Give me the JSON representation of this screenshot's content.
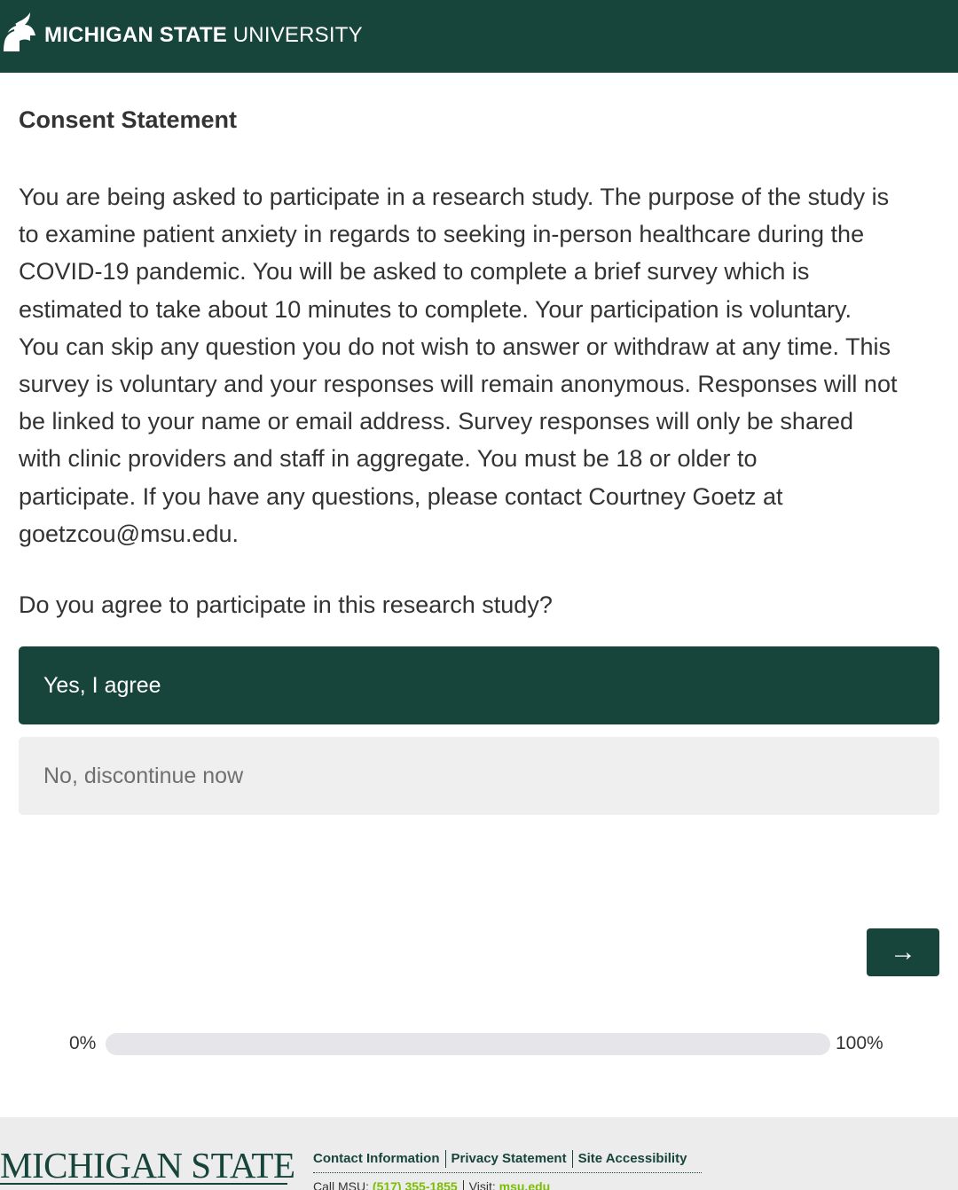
{
  "header": {
    "brand_bold": "MICHIGAN STATE",
    "brand_light": " UNIVERSITY",
    "logo_icon": "spartan-helmet-icon"
  },
  "consent": {
    "heading": "Consent Statement",
    "body": "You are being asked to participate in a research study. The purpose of the study is\nto examine patient anxiety in regards to seeking in-person healthcare during the\nCOVID-19 pandemic. You will be asked to complete a brief survey which is\nestimated to take about 10 minutes to complete. Your participation is voluntary.\nYou can skip any question you do not wish to answer or withdraw at any time. This\nsurvey is voluntary and your responses will remain anonymous. Responses will not\nbe linked to your name or email address. Survey responses will only be shared\nwith clinic providers and staff in aggregate. You must be 18 or older to\nparticipate.  If you have any questions, please contact Courtney Goetz at\ngoetzcou@msu.edu.",
    "question": "Do you agree to participate in this research study?",
    "choices": [
      {
        "label": "Yes, I agree",
        "selected": true
      },
      {
        "label": "No, discontinue now",
        "selected": false
      }
    ]
  },
  "navigation": {
    "next_label": "→",
    "next_icon": "arrow-right-icon"
  },
  "progress": {
    "start_label": "0%",
    "end_label": "100%",
    "value": 0
  },
  "footer": {
    "wordmark": "MICHIGAN STATE",
    "links": [
      "Contact Information",
      "Privacy Statement",
      "Site Accessibility"
    ],
    "call_label": "Call MSU: ",
    "phone": "(517) 355-1855",
    "visit_label": "Visit: ",
    "site": "msu.edu"
  },
  "colors": {
    "brand_green": "#18453b",
    "footer_accent": "#7bbd00",
    "unselected_choice_bg": "#efefef",
    "progress_track": "#e6e6ea"
  }
}
